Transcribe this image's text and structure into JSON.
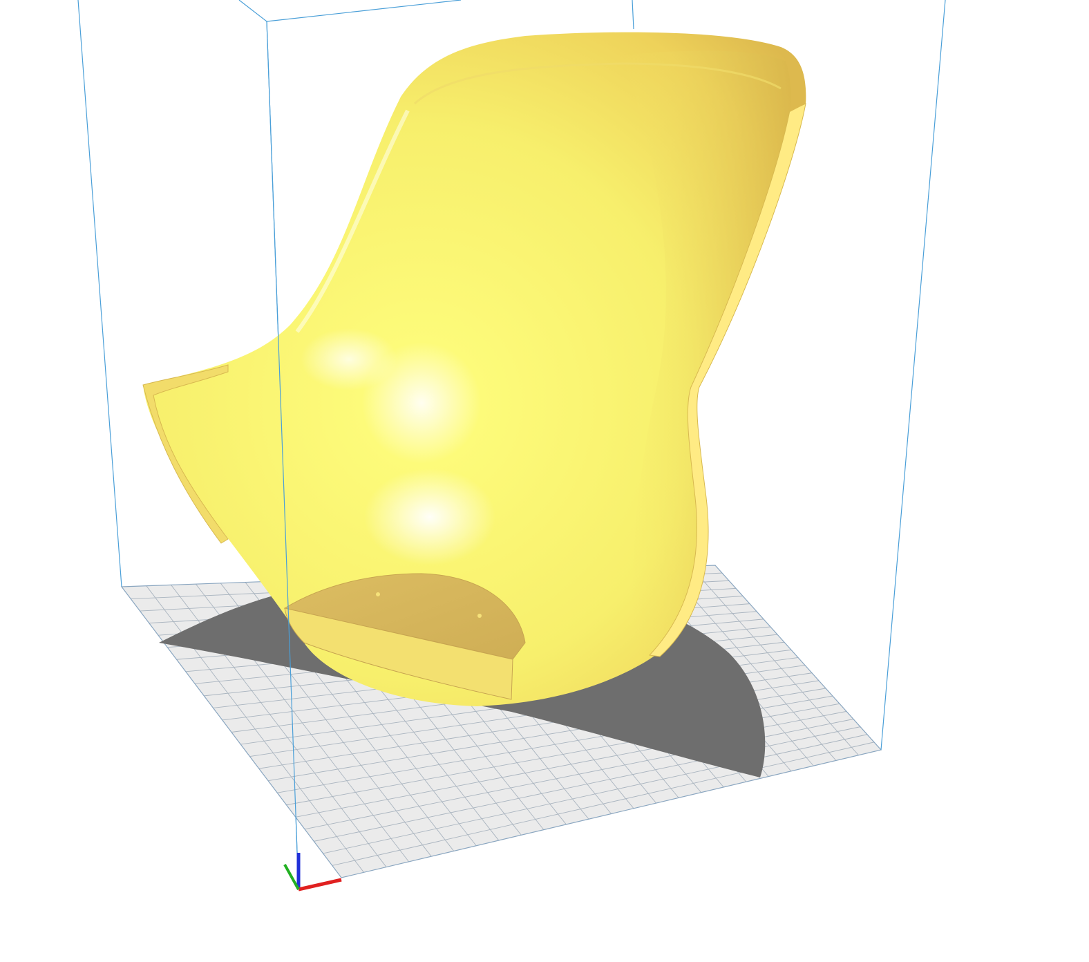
{
  "viewport": {
    "background": "#ffffff",
    "view_mode": "3d-perspective"
  },
  "build_volume": {
    "edge_color": "#4a9fd8"
  },
  "build_plate": {
    "fill_color": "#ebebeb",
    "grid_color": "#a9b4bf",
    "grid_divisions": 24
  },
  "model": {
    "type": "curved-shell",
    "color_light": "#fdfb7a",
    "color_mid": "#f6e366",
    "color_dark": "#ddb94e",
    "cut_face_color": "#d9b85c",
    "edge_highlight": "#ffe98a"
  },
  "shadow": {
    "color": "#6e6e6e"
  },
  "axis_gizmo": {
    "x_color": "#e02020",
    "y_color": "#22b022",
    "z_color": "#2030d8"
  }
}
